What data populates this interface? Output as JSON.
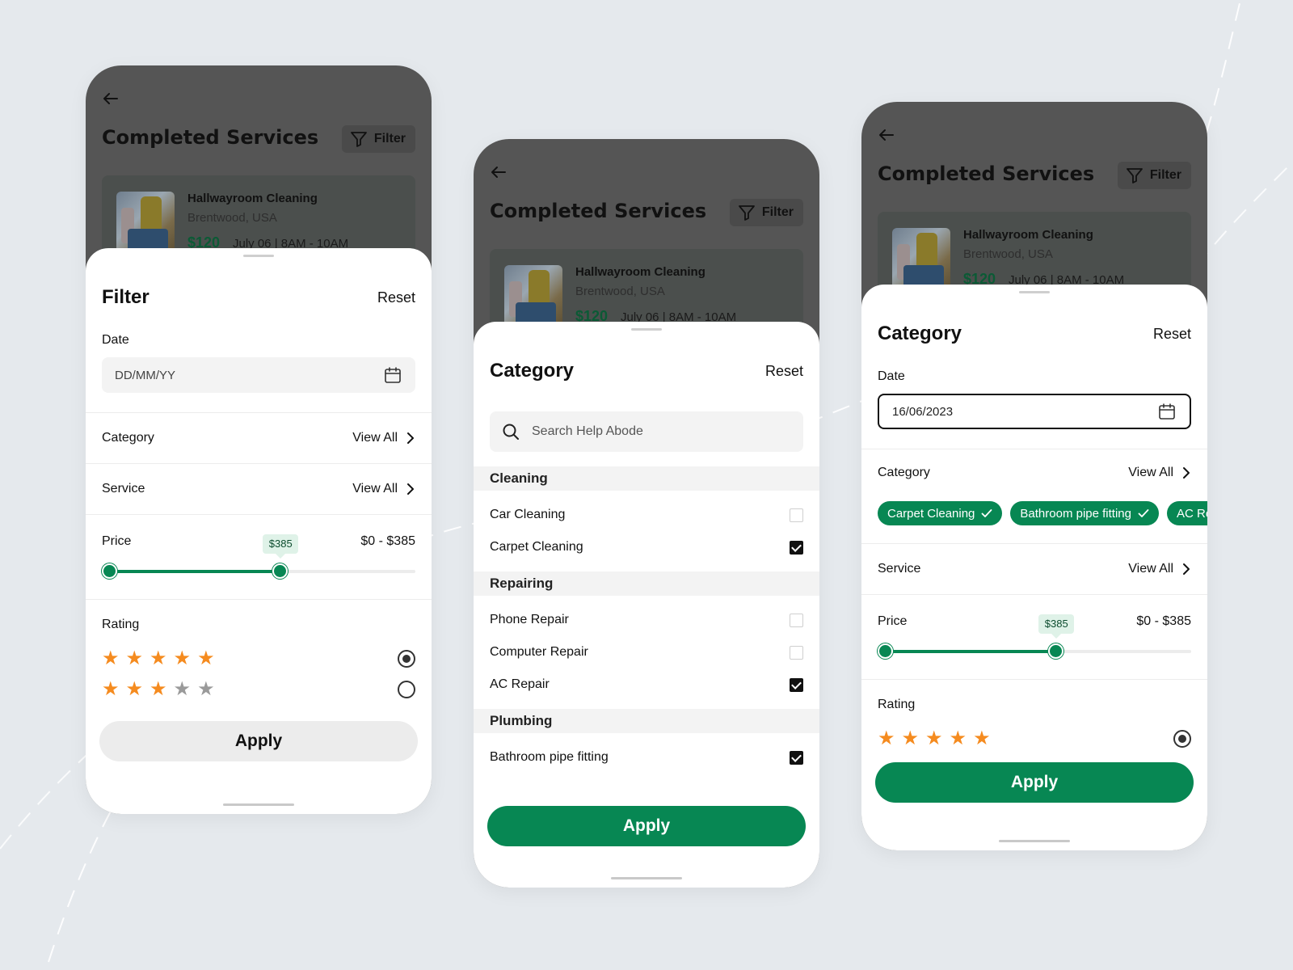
{
  "background_color": "#e5e9ed",
  "accent_color": "#078753",
  "star_color": "#f58b1f",
  "star_off_color": "#9a9a9a",
  "service_card": {
    "title": "Hallwayroom Cleaning",
    "location": "Brentwood, USA",
    "price": "$120",
    "time": "July 06 | 8AM - 10AM"
  },
  "header": {
    "title": "Completed Services",
    "filter_label": "Filter",
    "back_icon": "arrow-left-icon",
    "filter_icon": "funnel-icon"
  },
  "screen1": {
    "sheet_title": "Filter",
    "reset_label": "Reset",
    "date_label": "Date",
    "date_placeholder": "DD/MM/YY",
    "category_label": "Category",
    "service_label": "Service",
    "view_all_label": "View All",
    "price_label": "Price",
    "price_bubble": "$385",
    "price_range": "$0 - $385",
    "price_fraction": 0.56,
    "rating_label": "Rating",
    "ratings": [
      {
        "stars": 5,
        "selected": true
      },
      {
        "stars": 3,
        "selected": false
      }
    ],
    "apply_label": "Apply"
  },
  "screen2": {
    "sheet_title": "Category",
    "reset_label": "Reset",
    "search_placeholder": "Search Help Abode",
    "groups": [
      {
        "name": "Cleaning",
        "items": [
          {
            "label": "Car Cleaning",
            "checked": false
          },
          {
            "label": "Carpet Cleaning",
            "checked": true
          }
        ]
      },
      {
        "name": "Repairing",
        "items": [
          {
            "label": "Phone Repair",
            "checked": false
          },
          {
            "label": "Computer Repair",
            "checked": false
          },
          {
            "label": "AC Repair",
            "checked": true
          }
        ]
      },
      {
        "name": "Plumbing",
        "items": [
          {
            "label": "Bathroom pipe fitting",
            "checked": true
          }
        ]
      }
    ],
    "apply_label": "Apply"
  },
  "screen3": {
    "sheet_title": "Category",
    "reset_label": "Reset",
    "date_label": "Date",
    "date_value": "16/06/2023",
    "category_label": "Category",
    "view_all_label": "View All",
    "chips": [
      "Carpet Cleaning",
      "Bathroom pipe fitting",
      "AC Repair"
    ],
    "service_label": "Service",
    "price_label": "Price",
    "price_bubble": "$385",
    "price_range": "$0 - $385",
    "price_fraction": 0.56,
    "rating_label": "Rating",
    "ratings": [
      {
        "stars": 5,
        "selected": true
      }
    ],
    "apply_label": "Apply"
  }
}
